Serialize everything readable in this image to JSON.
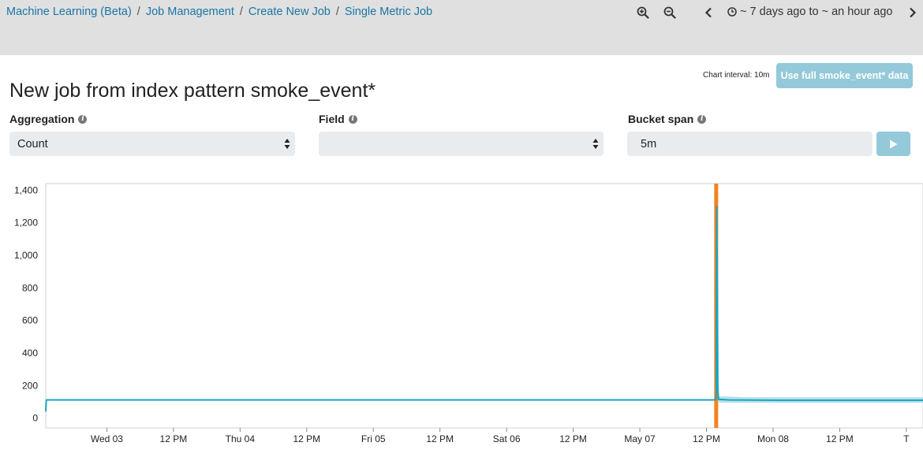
{
  "breadcrumbs": [
    {
      "label": "Machine Learning (Beta)"
    },
    {
      "label": "Job Management"
    },
    {
      "label": "Create New Job"
    },
    {
      "label": "Single Metric Job"
    }
  ],
  "breadcrumb_separator": "/",
  "toolbar": {
    "zoom_in_icon": "zoom-in-icon",
    "zoom_out_icon": "zoom-out-icon",
    "prev_icon": "chevron-left-icon",
    "next_icon": "chevron-right-icon",
    "time_range": "~ 7 days ago to ~ an hour ago"
  },
  "header": {
    "chart_interval": "Chart interval: 10m",
    "full_data_button": "Use full smoke_event* data",
    "title": "New job from index pattern smoke_event*"
  },
  "form": {
    "aggregation": {
      "label": "Aggregation",
      "value": "Count"
    },
    "field": {
      "label": "Field",
      "value": ""
    },
    "bucket_span": {
      "label": "Bucket span",
      "value": "5m"
    }
  },
  "colors": {
    "accent": "#1a76a3",
    "button": "#93c9d9",
    "line": "#18a5c2",
    "band": "#a9dce6",
    "marker": "#f58220"
  },
  "chart_data": {
    "type": "line",
    "y_ticks": [
      "1,400",
      "1,200",
      "1,000",
      "800",
      "600",
      "400",
      "200",
      "0"
    ],
    "y_tick_values": [
      1400,
      1200,
      1000,
      800,
      600,
      400,
      200,
      0
    ],
    "ylim": [
      -60,
      1440
    ],
    "x_ticks": [
      "Wed 03",
      "12 PM",
      "Thu 04",
      "12 PM",
      "Fri 05",
      "12 PM",
      "Sat 06",
      "12 PM",
      "May 07",
      "12 PM",
      "Mon 08",
      "12 PM",
      "T"
    ],
    "x_tick_hours": [
      0,
      12,
      24,
      36,
      48,
      60,
      72,
      84,
      96,
      108,
      120,
      132,
      144
    ],
    "xlim_hours": [
      -11,
      147
    ],
    "series": [
      {
        "points": [
          [
            -11,
            40
          ],
          [
            -10.9,
            112
          ],
          [
            0,
            112
          ],
          [
            24,
            112
          ],
          [
            48,
            112
          ],
          [
            72,
            112
          ],
          [
            96,
            112
          ],
          [
            108,
            112
          ],
          [
            109.6,
            112
          ],
          [
            109.75,
            140
          ],
          [
            109.85,
            1300
          ],
          [
            109.95,
            900
          ],
          [
            110.05,
            200
          ],
          [
            110.15,
            115
          ],
          [
            112,
            112
          ],
          [
            120,
            110
          ],
          [
            130,
            110
          ],
          [
            147,
            110
          ]
        ]
      }
    ],
    "band": {
      "upper": [
        [
          110.2,
          135
        ],
        [
          115,
          128
        ],
        [
          130,
          128
        ],
        [
          147,
          128
        ]
      ],
      "lower": [
        [
          110.2,
          95
        ],
        [
          115,
          95
        ],
        [
          130,
          95
        ],
        [
          147,
          95
        ]
      ]
    },
    "marker_hour": 109.75,
    "grid": false
  }
}
